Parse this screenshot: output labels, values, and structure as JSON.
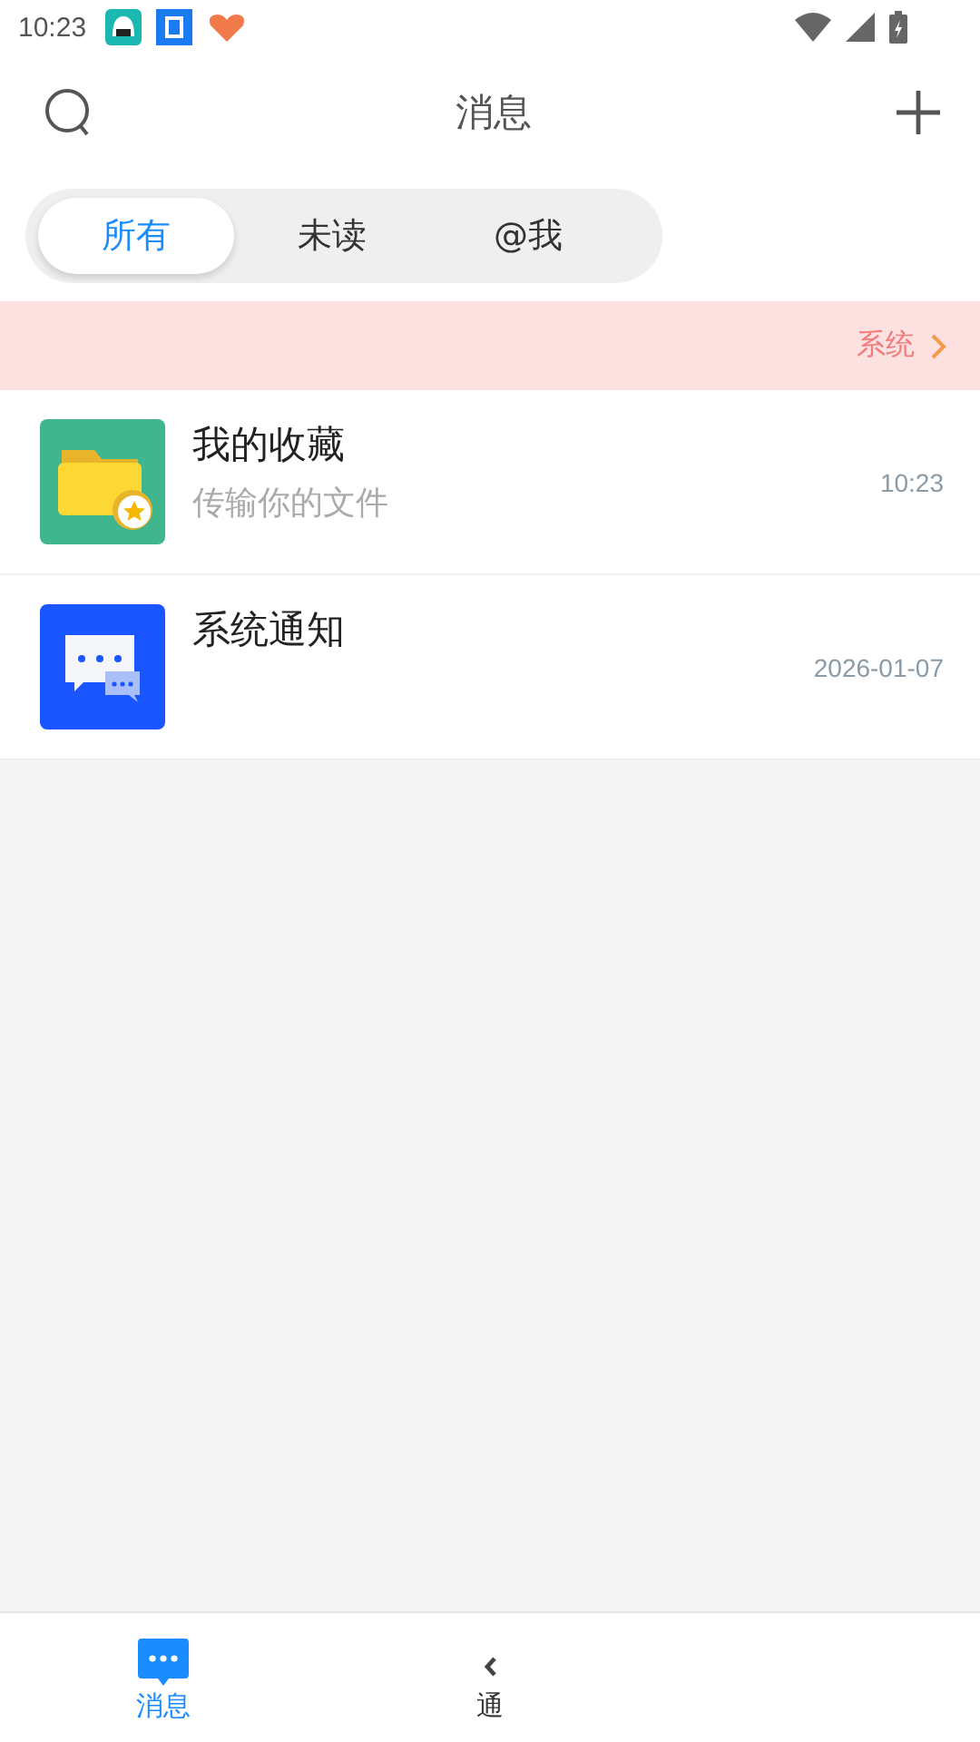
{
  "status_bar": {
    "time": "10:23"
  },
  "header": {
    "title": "消息"
  },
  "tabs": [
    {
      "label": "所有",
      "selected": true
    },
    {
      "label": "未读",
      "selected": false
    },
    {
      "label": "@我",
      "selected": false
    }
  ],
  "notice_bar": {
    "text": "系统"
  },
  "conversations": [
    {
      "kind": "favorites",
      "name": "我的收藏",
      "preview": "传输你的文件",
      "time": "10:23"
    },
    {
      "kind": "system",
      "name": "系统通知",
      "time": "2026-01-07"
    }
  ],
  "bottom_nav": [
    {
      "kind": "messages",
      "label": "消息",
      "selected": true
    },
    {
      "kind": "contacts",
      "label": "通",
      "selected": false
    }
  ]
}
